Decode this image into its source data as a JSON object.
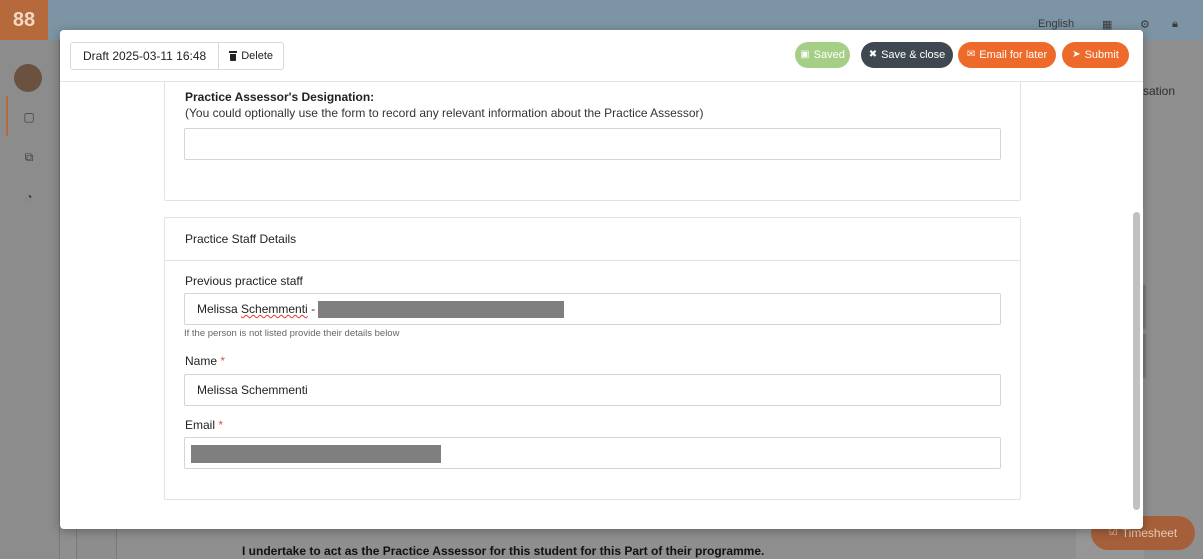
{
  "background": {
    "logo_glyph": "88",
    "right_text": "sation",
    "top_right_text": "English",
    "bottom_statement": "I undertake to act as the Practice Assessor for this student for this Part of their programme.",
    "timesheet_label": "Timesheet"
  },
  "modal": {
    "draft_label": "Draft 2025-03-11 16:48",
    "delete_label": "Delete",
    "buttons": {
      "saved": "Saved",
      "save_close": "Save & close",
      "email_later": "Email for later",
      "submit": "Submit"
    },
    "colors": {
      "saved": "#a5cf86",
      "save_close": "#3f4850",
      "accent": "#ee6a2a"
    }
  },
  "designation_section": {
    "label": "Practice Assessor's Designation:",
    "help": "(You could optionally use the form to record any relevant information about the Practice Assessor)",
    "value": ""
  },
  "staff_section": {
    "title": "Practice Staff Details",
    "previous_label": "Previous practice staff",
    "previous_value_first": "Melissa",
    "previous_value_last": "Schemmenti",
    "previous_value_sep": " -",
    "previous_help": "If the person is not listed provide their details below",
    "name_label": "Name",
    "name_required": "*",
    "name_value": "Melissa Schemmenti",
    "email_label": "Email",
    "email_required": "*"
  }
}
